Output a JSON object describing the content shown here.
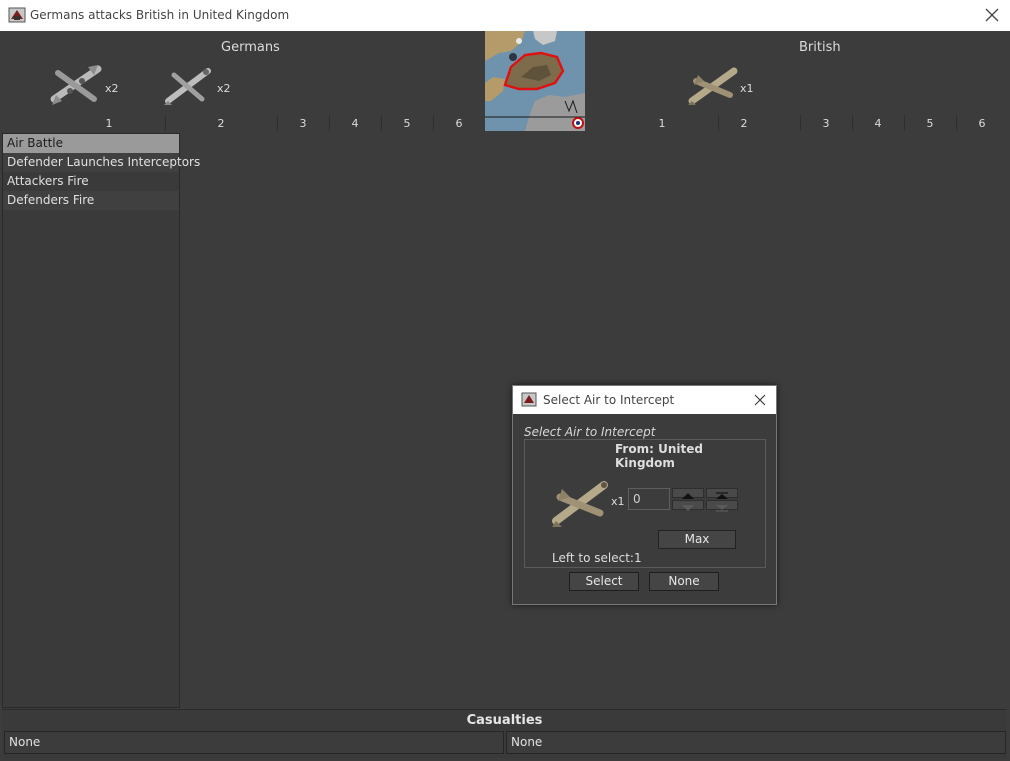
{
  "window": {
    "title": "Germans attacks British in United Kingdom"
  },
  "battle": {
    "attacker": {
      "name": "Germans",
      "units": [
        {
          "icon": "bomber-plane-icon",
          "count": "x2"
        },
        {
          "icon": "fighter-plane-icon",
          "count": "x2"
        }
      ]
    },
    "defender": {
      "name": "British",
      "units": [
        {
          "icon": "fighter-plane-icon",
          "count": "x1"
        }
      ]
    },
    "attacker_dice": [
      "1",
      "2",
      "3",
      "4",
      "5",
      "6"
    ],
    "defender_dice": [
      "1",
      "2",
      "3",
      "4",
      "5",
      "6"
    ]
  },
  "steps": [
    {
      "label": "Air Battle",
      "selected": true
    },
    {
      "label": "Defender Launches Interceptors",
      "selected": false
    },
    {
      "label": "Attackers Fire",
      "selected": false
    },
    {
      "label": "Defenders Fire",
      "selected": false
    }
  ],
  "casualties": {
    "title": "Casualties",
    "attacker": "None",
    "defender": "None"
  },
  "dialog": {
    "title": "Select Air to Intercept",
    "heading": "Select Air to Intercept",
    "from": "From: United Kingdom",
    "unit_count": "x1",
    "input_value": "0",
    "max_label": "Max",
    "left_to_select": "Left to select:1",
    "select_label": "Select",
    "none_label": "None"
  },
  "colors": {
    "background": "#3c3c3c",
    "selected_step": "#9a9a9a",
    "territory_border": "#e01010"
  }
}
